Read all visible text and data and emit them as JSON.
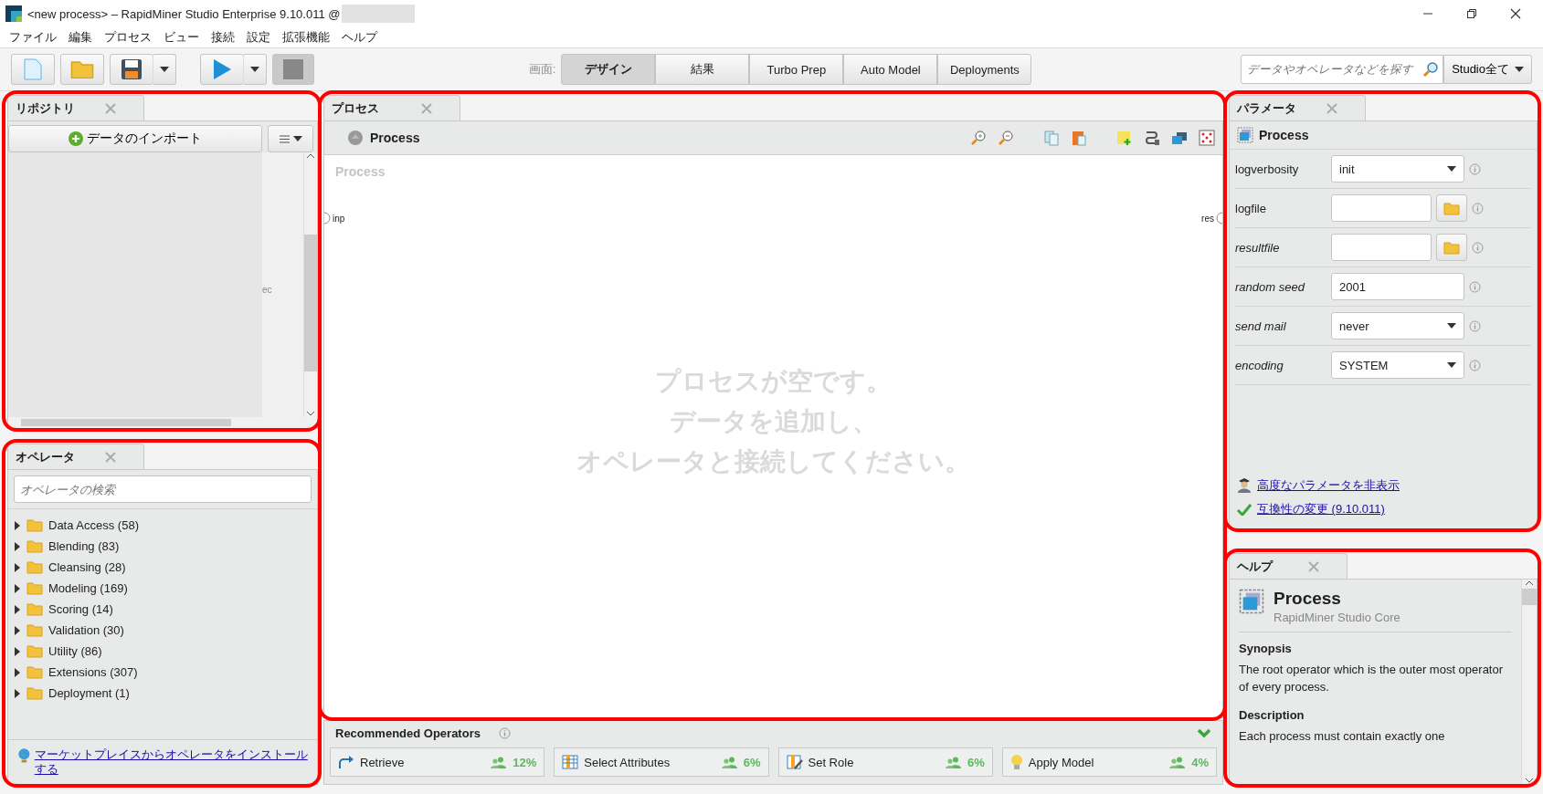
{
  "window": {
    "title": "<new process> – RapidMiner Studio Enterprise 9.10.011 @"
  },
  "menu": [
    "ファイル",
    "編集",
    "プロセス",
    "ビュー",
    "接続",
    "設定",
    "拡張機能",
    "ヘルプ"
  ],
  "perspective": {
    "label": "画面:",
    "tabs": [
      {
        "label": "デザイン",
        "selected": true
      },
      {
        "label": "結果",
        "selected": false
      },
      {
        "label": "Turbo Prep",
        "selected": false
      },
      {
        "label": "Auto Model",
        "selected": false
      },
      {
        "label": "Deployments",
        "selected": false
      }
    ]
  },
  "search": {
    "placeholder": "データやオペレータなどを探す",
    "scope": "Studio全て"
  },
  "repository": {
    "tab": "リポジトリ",
    "highlighted": true,
    "import_button": "データのインポート",
    "fragment": "ec"
  },
  "operators": {
    "tab": "オペレータ",
    "highlighted": true,
    "search_placeholder": "オペレータの検索",
    "groups": [
      {
        "label": "Data Access (58)",
        "expanded": false
      },
      {
        "label": "Blending (83)",
        "expanded": false
      },
      {
        "label": "Cleansing (28)",
        "expanded": false
      },
      {
        "label": "Modeling (169)",
        "expanded": false
      },
      {
        "label": "Scoring (14)",
        "expanded": false
      },
      {
        "label": "Validation (30)",
        "expanded": false
      },
      {
        "label": "Utility (86)",
        "expanded": false
      },
      {
        "label": "Extensions (307)",
        "expanded": false
      },
      {
        "label": "Deployment (1)",
        "expanded": false
      }
    ],
    "marketplace_link": "マーケットプレイスからオペレータをインストールする"
  },
  "process": {
    "tab": "プロセス",
    "highlighted": true,
    "breadcrumb": "Process",
    "canvas_title": "Process",
    "input_port": "inp",
    "output_port": "res",
    "empty_message": [
      "プロセスが空です。",
      "データを追加し、",
      "オペレータと接続してください。"
    ]
  },
  "recommended": {
    "title": "Recommended Operators",
    "items": [
      {
        "label": "Retrieve",
        "share": "12%"
      },
      {
        "label": "Select Attributes",
        "share": "6%"
      },
      {
        "label": "Set Role",
        "share": "6%"
      },
      {
        "label": "Apply Model",
        "share": "4%"
      }
    ]
  },
  "parameters": {
    "tab": "パラメータ",
    "highlighted": true,
    "operator": "Process",
    "rows": [
      {
        "name": "logverbosity",
        "kind": "select",
        "value": "init",
        "expert": false
      },
      {
        "name": "logfile",
        "kind": "file",
        "expert": false
      },
      {
        "name": "resultfile",
        "kind": "file",
        "expert": true
      },
      {
        "name": "random seed",
        "kind": "text",
        "value": "2001",
        "expert": true
      },
      {
        "name": "send mail",
        "kind": "select",
        "value": "never",
        "expert": true
      },
      {
        "name": "encoding",
        "kind": "select",
        "value": "SYSTEM",
        "expert": true
      }
    ],
    "links": [
      {
        "kind": "expert",
        "label": "高度なパラメータを非表示"
      },
      {
        "kind": "compat",
        "label": "互換性の変更 (9.10.011)"
      }
    ]
  },
  "help": {
    "tab": "ヘルプ",
    "highlighted": true,
    "title": "Process",
    "subtitle": "RapidMiner Studio Core",
    "sections": [
      {
        "heading": "Synopsis",
        "text": "The root operator which is the outer most operator of every process."
      },
      {
        "heading": "Description",
        "text": "Each process must contain exactly one"
      }
    ]
  }
}
